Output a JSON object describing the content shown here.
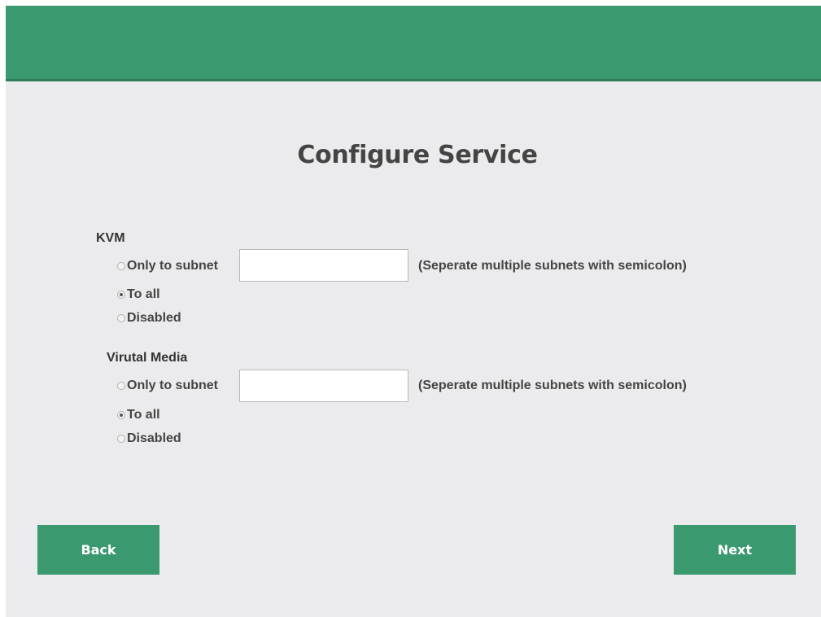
{
  "page": {
    "title": "Configure Service"
  },
  "colors": {
    "header": "#3b9970",
    "background": "#ebebed",
    "button": "#3b9970"
  },
  "sections": [
    {
      "label": "KVM",
      "options": [
        {
          "label": "Only to subnet",
          "checked": false
        },
        {
          "label": "To all",
          "checked": true
        },
        {
          "label": "Disabled",
          "checked": false
        }
      ],
      "subnet_value": "",
      "hint": "(Seperate multiple subnets with semicolon)"
    },
    {
      "label": "Virutal Media",
      "options": [
        {
          "label": "Only to subnet",
          "checked": false
        },
        {
          "label": "To all",
          "checked": true
        },
        {
          "label": "Disabled",
          "checked": false
        }
      ],
      "subnet_value": "",
      "hint": "(Seperate multiple subnets with semicolon)"
    }
  ],
  "buttons": {
    "back": "Back",
    "next": "Next"
  }
}
